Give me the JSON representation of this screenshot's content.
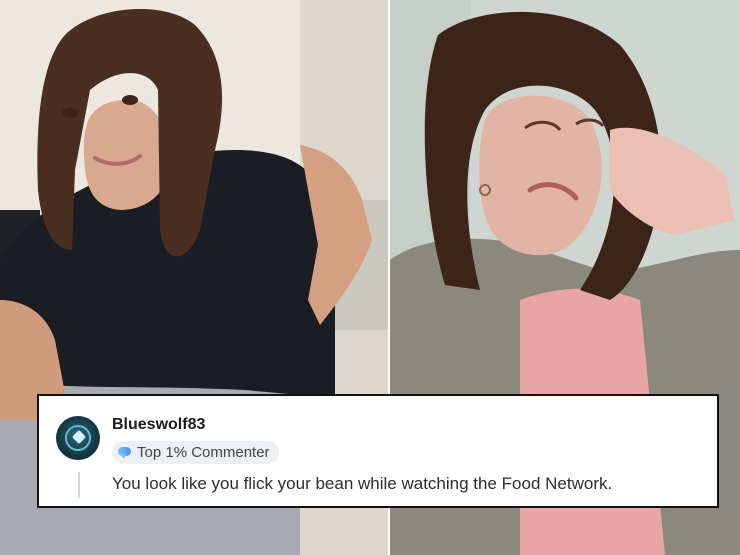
{
  "photos": [
    {
      "name": "left-photo"
    },
    {
      "name": "right-photo"
    }
  ],
  "comment": {
    "username": "Blueswolf83",
    "badge_label": "Top 1% Commenter",
    "text": "You look like you flick your bean while watching the Food Network.",
    "avatar_icon": "avatar-badge-icon",
    "badge_icon": "comment-bubble-icon",
    "colors": {
      "card_background": "#ffffff",
      "card_border": "#111111",
      "badge_background": "#edf0f3",
      "text_primary": "#1c1c1c",
      "text_secondary": "#3f464c"
    }
  }
}
